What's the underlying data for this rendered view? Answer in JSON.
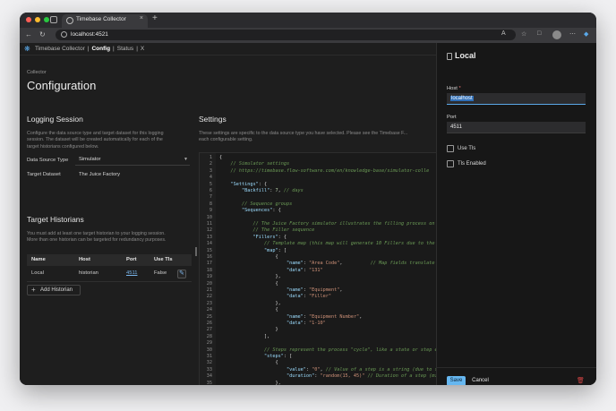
{
  "browser": {
    "tab_title": "Timebase Collector",
    "url": "localhost:4521",
    "new_tab": "+",
    "close_tab": "×"
  },
  "appnav": {
    "brand": "Timebase Collector",
    "sep1": "|",
    "config": "Config",
    "sep2": "|",
    "status": "Status",
    "sep3": "|",
    "extra": "X"
  },
  "page": {
    "breadcrumb": "Collector",
    "title": "Configuration"
  },
  "logging_session": {
    "title": "Logging Session",
    "description": [
      "Configure the data source type and target dataset for this logging",
      "session. The dataset will be created automatically for each of the",
      "target historians configured below."
    ],
    "data_source_label": "Data Source Type",
    "data_source_value": "Simulator",
    "target_dataset_label": "Target Dataset",
    "target_dataset_value": "The Juice Factory"
  },
  "target_historians": {
    "title": "Target Historians",
    "description": [
      "You must add at least one target historian to your logging session.",
      "More than one historian can be targeted for redundancy purposes."
    ],
    "columns": [
      "Name",
      "Host",
      "Port",
      "Use Tls"
    ],
    "rows": [
      {
        "name": "Local",
        "host": "historian",
        "port": "4511",
        "use_tls": "False"
      }
    ],
    "add_button": "Add Historian"
  },
  "settings": {
    "title": "Settings",
    "description": "These settings are specific to the data source type you have selected. Please see the Timebase F...",
    "description2": "each configurable setting.",
    "code_lines": [
      [
        {
          "t": "{",
          "c": ""
        }
      ],
      [
        {
          "t": "    // Simulator settings",
          "c": "cm"
        }
      ],
      [
        {
          "t": "    // https://timebase.flow-software.com/en/knowledge-base/simulator-colle",
          "c": "cm"
        }
      ],
      [],
      [
        {
          "t": "    ",
          "c": ""
        },
        {
          "t": "\"Settings\"",
          "c": "key"
        },
        {
          "t": ": {",
          "c": ""
        }
      ],
      [
        {
          "t": "        ",
          "c": ""
        },
        {
          "t": "\"Backfill\"",
          "c": "key"
        },
        {
          "t": ": ",
          "c": ""
        },
        {
          "t": "7",
          "c": "num"
        },
        {
          "t": ", ",
          "c": ""
        },
        {
          "t": "// days",
          "c": "cm"
        }
      ],
      [],
      [
        {
          "t": "        // Sequence groups",
          "c": "cm"
        }
      ],
      [
        {
          "t": "        ",
          "c": ""
        },
        {
          "t": "\"Sequences\"",
          "c": "key"
        },
        {
          "t": ": {",
          "c": ""
        }
      ],
      [],
      [
        {
          "t": "            // The Juice Factory simulator illustrates the filling process on a",
          "c": "cm"
        }
      ],
      [
        {
          "t": "            // The Filler sequence",
          "c": "cm"
        }
      ],
      [
        {
          "t": "            ",
          "c": ""
        },
        {
          "t": "\"Fillers\"",
          "c": "key"
        },
        {
          "t": ": {",
          "c": ""
        }
      ],
      [
        {
          "t": "                // Template map (this map will generate 10 Fillers due to the 'Eq",
          "c": "cm"
        }
      ],
      [
        {
          "t": "                ",
          "c": ""
        },
        {
          "t": "\"map\"",
          "c": "key"
        },
        {
          "t": ": [",
          "c": ""
        }
      ],
      [
        {
          "t": "                    {",
          "c": ""
        }
      ],
      [
        {
          "t": "                        ",
          "c": ""
        },
        {
          "t": "\"name\"",
          "c": "key"
        },
        {
          "t": ": ",
          "c": ""
        },
        {
          "t": "\"Area Code\"",
          "c": "str"
        },
        {
          "t": ",          ",
          "c": ""
        },
        {
          "t": "// Map fields translate to tag p",
          "c": "cm"
        }
      ],
      [
        {
          "t": "                        ",
          "c": ""
        },
        {
          "t": "\"data\"",
          "c": "key"
        },
        {
          "t": ": ",
          "c": ""
        },
        {
          "t": "\"131\"",
          "c": "str"
        }
      ],
      [
        {
          "t": "                    },",
          "c": ""
        }
      ],
      [
        {
          "t": "                    {",
          "c": ""
        }
      ],
      [
        {
          "t": "                        ",
          "c": ""
        },
        {
          "t": "\"name\"",
          "c": "key"
        },
        {
          "t": ": ",
          "c": ""
        },
        {
          "t": "\"Equipment\"",
          "c": "str"
        },
        {
          "t": ",",
          "c": ""
        }
      ],
      [
        {
          "t": "                        ",
          "c": ""
        },
        {
          "t": "\"data\"",
          "c": "key"
        },
        {
          "t": ": ",
          "c": ""
        },
        {
          "t": "\"Filler\"",
          "c": "str"
        }
      ],
      [
        {
          "t": "                    },",
          "c": ""
        }
      ],
      [
        {
          "t": "                    {",
          "c": ""
        }
      ],
      [
        {
          "t": "                        ",
          "c": ""
        },
        {
          "t": "\"name\"",
          "c": "key"
        },
        {
          "t": ": ",
          "c": ""
        },
        {
          "t": "\"Equipment Number\"",
          "c": "str"
        },
        {
          "t": ",",
          "c": ""
        }
      ],
      [
        {
          "t": "                        ",
          "c": ""
        },
        {
          "t": "\"data\"",
          "c": "key"
        },
        {
          "t": ": ",
          "c": ""
        },
        {
          "t": "\"1-10\"",
          "c": "str"
        }
      ],
      [
        {
          "t": "                    }",
          "c": ""
        }
      ],
      [
        {
          "t": "                ],",
          "c": ""
        }
      ],
      [],
      [
        {
          "t": "                // Steps represent the process \"cycle\", like a state or step engi",
          "c": "cm"
        }
      ],
      [
        {
          "t": "                ",
          "c": ""
        },
        {
          "t": "\"steps\"",
          "c": "key"
        },
        {
          "t": ": [",
          "c": ""
        }
      ],
      [
        {
          "t": "                    {",
          "c": ""
        }
      ],
      [
        {
          "t": "                        ",
          "c": ""
        },
        {
          "t": "\"value\"",
          "c": "key"
        },
        {
          "t": ": ",
          "c": ""
        },
        {
          "t": "\"0\"",
          "c": "str"
        },
        {
          "t": ", ",
          "c": ""
        },
        {
          "t": "// Value of a step is a string (due to function",
          "c": "cm"
        }
      ],
      [
        {
          "t": "                        ",
          "c": ""
        },
        {
          "t": "\"duration\"",
          "c": "key"
        },
        {
          "t": ": ",
          "c": ""
        },
        {
          "t": "\"random(15, 45)\"",
          "c": "str"
        },
        {
          "t": " ",
          "c": ""
        },
        {
          "t": "// Duration of a step (minutes) c",
          "c": "cm"
        }
      ],
      [
        {
          "t": "                    },",
          "c": ""
        }
      ]
    ]
  },
  "panel": {
    "title": "Local",
    "host_label": "Host",
    "host_required": "*",
    "host_value": "localhost",
    "port_label": "Port",
    "port_value": "4511",
    "use_tls_label": "Use Tls",
    "tls_enabled_label": "Tls Enabled",
    "save": "Save",
    "cancel": "Cancel"
  },
  "icons": {
    "logo": "timebase-logo-icon",
    "edit": "pencil-icon",
    "delete": "trash-icon"
  },
  "colors": {
    "accent": "#66b7f0",
    "background": "#1e1e1e",
    "panel": "#171717",
    "danger": "#d04444"
  }
}
